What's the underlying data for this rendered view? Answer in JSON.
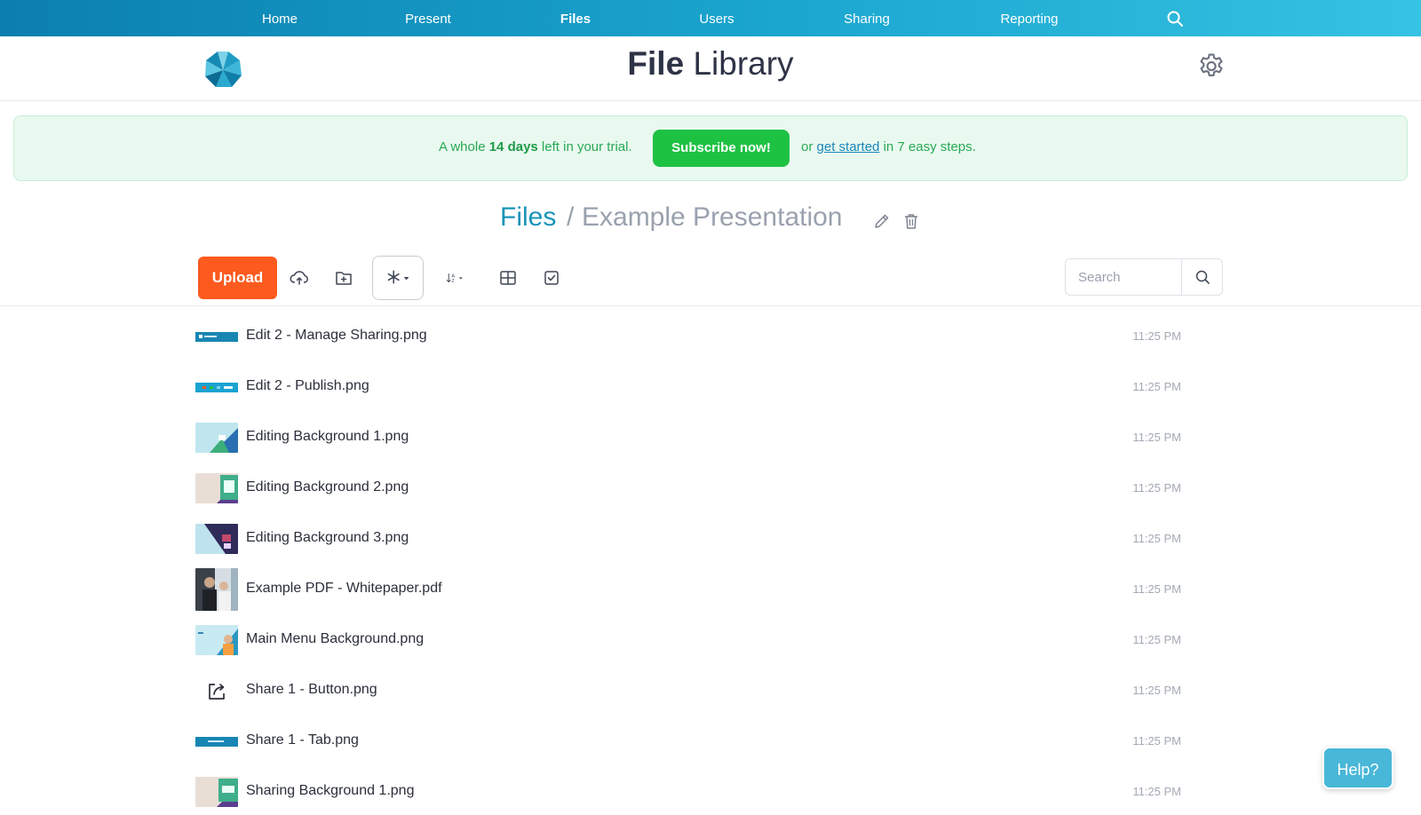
{
  "nav": {
    "items": [
      {
        "label": "Home",
        "active": false
      },
      {
        "label": "Present",
        "active": false
      },
      {
        "label": "Files",
        "active": true
      },
      {
        "label": "Users",
        "active": false
      },
      {
        "label": "Sharing",
        "active": false
      },
      {
        "label": "Reporting",
        "active": false
      }
    ],
    "search_icon": "search-icon"
  },
  "header": {
    "title_bold": "File",
    "title_rest": " Library",
    "logo_icon": "flower-logo",
    "settings_icon": "gear-icon"
  },
  "banner": {
    "prefix": "A whole ",
    "days": "14 days",
    "suffix": " left in your trial.",
    "subscribe_label": "Subscribe now!",
    "or_text": "or ",
    "link_label": "get started",
    "steps_text": " in 7 easy steps."
  },
  "breadcrumb": {
    "root": "Files",
    "separator": "/",
    "current": "Example Presentation",
    "edit_icon": "pencil-icon",
    "delete_icon": "trash-icon"
  },
  "toolbar": {
    "upload_label": "Upload",
    "icons": [
      "cloud-upload-icon",
      "new-folder-icon",
      "asterisk-filter-icon",
      "sort-az-icon",
      "grid-view-icon",
      "select-checkbox-icon"
    ],
    "search_placeholder": "Search",
    "search_icon": "search-icon"
  },
  "files": [
    {
      "name": "Edit 2 - Manage Sharing.png",
      "time": "11:25 PM",
      "thumb": "sharing-tab"
    },
    {
      "name": "Edit 2 - Publish.png",
      "time": "11:25 PM",
      "thumb": "publish-bar"
    },
    {
      "name": "Editing Background 1.png",
      "time": "11:25 PM",
      "thumb": "bg1"
    },
    {
      "name": "Editing Background 2.png",
      "time": "11:25 PM",
      "thumb": "bg2"
    },
    {
      "name": "Editing Background 3.png",
      "time": "11:25 PM",
      "thumb": "bg3"
    },
    {
      "name": "Example PDF - Whitepaper.pdf",
      "time": "11:25 PM",
      "thumb": "photo"
    },
    {
      "name": "Main Menu Background.png",
      "time": "11:25 PM",
      "thumb": "menu-bg"
    },
    {
      "name": "Share 1 - Button.png",
      "time": "11:25 PM",
      "thumb": "share-icon"
    },
    {
      "name": "Share 1 - Tab.png",
      "time": "11:25 PM",
      "thumb": "sharing-tab-small"
    },
    {
      "name": "Sharing Background 1.png",
      "time": "11:25 PM",
      "thumb": "bg2"
    }
  ],
  "help": {
    "label": "Help?"
  },
  "colors": {
    "accent": "#1994b8",
    "upload": "#fc5a1e",
    "subscribe": "#1ec243",
    "banner_bg": "#e9f9ef"
  }
}
